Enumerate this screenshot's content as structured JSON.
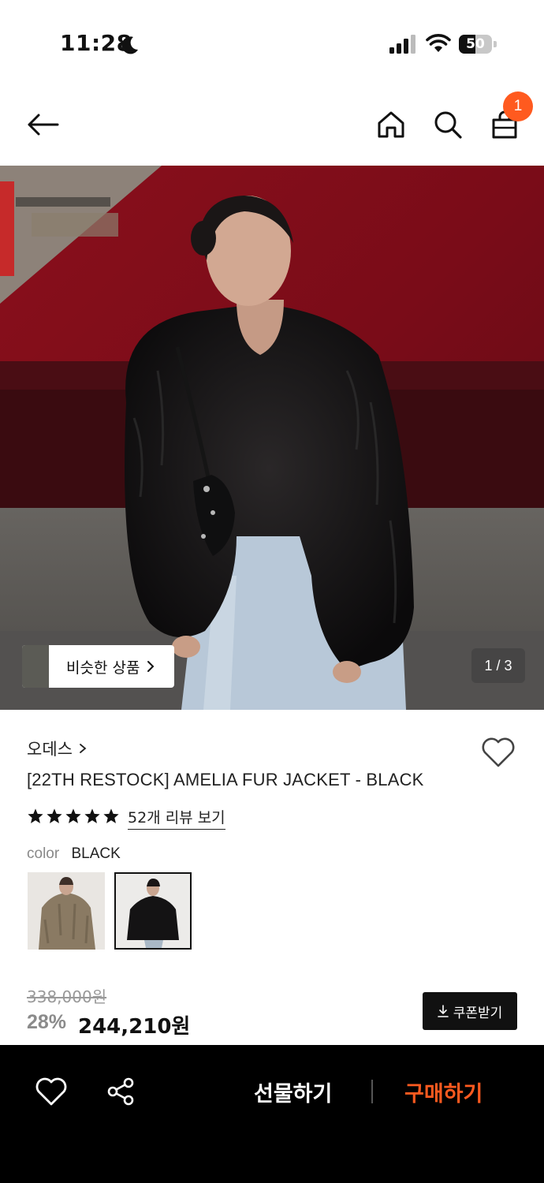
{
  "status_bar": {
    "time": "11:28",
    "battery_level": 50,
    "battery_text": "50"
  },
  "header": {
    "cart_count": "1"
  },
  "gallery": {
    "similar_label": "비슷한 상품",
    "page_indicator": "1 / 3"
  },
  "product": {
    "brand": "오데스",
    "title": "[22TH RESTOCK] AMELIA FUR JACKET - BLACK",
    "rating_stars": 5,
    "review_link": "52개 리뷰 보기",
    "color_key": "color",
    "color_value": "BLACK"
  },
  "pricing": {
    "original": "338,000원",
    "discount": "28%",
    "final": "244,210원",
    "coupon_label": "쿠폰받기"
  },
  "bottom_bar": {
    "gift_label": "선물하기",
    "buy_label": "구매하기"
  },
  "colors": {
    "accent": "#ff5a1f",
    "dark": "#111111",
    "muted": "#8b8b8b"
  },
  "icons": [
    "moon-icon",
    "signal-icon",
    "wifi-icon",
    "battery-icon",
    "back-arrow-icon",
    "home-icon",
    "search-icon",
    "shopping-bag-icon",
    "chevron-right-icon",
    "heart-icon",
    "star-icon",
    "download-icon",
    "share-icon"
  ]
}
